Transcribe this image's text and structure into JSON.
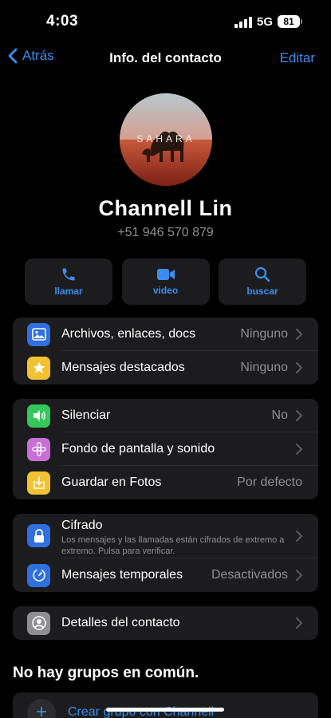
{
  "status": {
    "time": "4:03",
    "network": "5G",
    "battery": "81"
  },
  "nav": {
    "back_label": "Atrás",
    "title": "Info. del contacto",
    "edit_label": "Editar"
  },
  "avatar_text": "SAHARA",
  "contact": {
    "name": "Channell  Lin",
    "phone": "+51 946 570 879"
  },
  "actions": [
    {
      "label": "llamar",
      "icon": "phone-icon"
    },
    {
      "label": "video",
      "icon": "video-icon"
    },
    {
      "label": "buscar",
      "icon": "search-icon"
    }
  ],
  "media_section": [
    {
      "label": "Archivos, enlaces, docs",
      "value": "Ninguno",
      "icon": "photo-icon",
      "color": "#2f6fe0"
    },
    {
      "label": "Mensajes destacados",
      "value": "Ninguno",
      "icon": "star-icon",
      "color": "#f2c230"
    }
  ],
  "settings_section": [
    {
      "label": "Silenciar",
      "value": "No",
      "icon": "speaker-icon",
      "color": "#34c759"
    },
    {
      "label": "Fondo de pantalla y sonido",
      "value": "",
      "icon": "flower-icon",
      "color": "#c86fd6"
    },
    {
      "label": "Guardar en Fotos",
      "value": "Por defecto",
      "icon": "save-icon",
      "color": "#f2c230"
    }
  ],
  "security_section": {
    "encryption_label": "Cifrado",
    "encryption_sub": "Los mensajes y las llamadas están cifrados de extremo a extremo. Pulsa para verificar.",
    "temporary_label": "Mensajes temporales",
    "temporary_value": "Desactivados",
    "colors": {
      "lock": "#2f6fe0",
      "timer": "#2f6fe0"
    }
  },
  "details_label": "Detalles del contacto",
  "groups_title": "No hay grupos en común.",
  "create_group_label": "Crear grupo con Channell",
  "accent_color": "#3b8ef0"
}
